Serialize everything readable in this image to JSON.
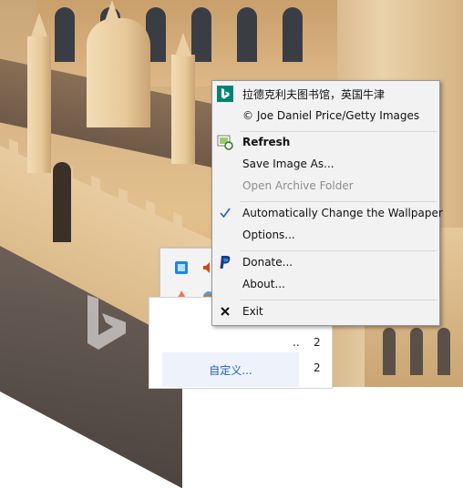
{
  "wallpaper": {
    "description_icon": "bing-watermark-icon"
  },
  "context_menu": {
    "items": [
      {
        "label": "拉德克利夫图书馆，英国牛津",
        "icon": "bing-logo-icon"
      },
      {
        "label": "© Joe Daniel Price/Getty Images"
      },
      {
        "label": "Refresh",
        "icon": "refresh-icon"
      },
      {
        "label": "Save Image As..."
      },
      {
        "label": "Open Archive Folder"
      },
      {
        "label": "Automatically Change the Wallpaper",
        "icon": "checkmark-icon"
      },
      {
        "label": "Options..."
      },
      {
        "label": "Donate...",
        "icon": "paypal-icon"
      },
      {
        "label": "About..."
      },
      {
        "label": "Exit",
        "icon": "close-icon"
      }
    ]
  },
  "jumplist": {
    "rows": [
      {
        "dots": "..",
        "num": "2"
      },
      {
        "dots": "..",
        "num": "2"
      }
    ],
    "customize_label": "自定义..."
  },
  "colors": {
    "menu_bg": "#f2f2f2",
    "menu_border": "#979797",
    "disabled_text": "#8d8d8d",
    "link_blue": "#1f5fbf",
    "bing_teal": "#008373"
  }
}
